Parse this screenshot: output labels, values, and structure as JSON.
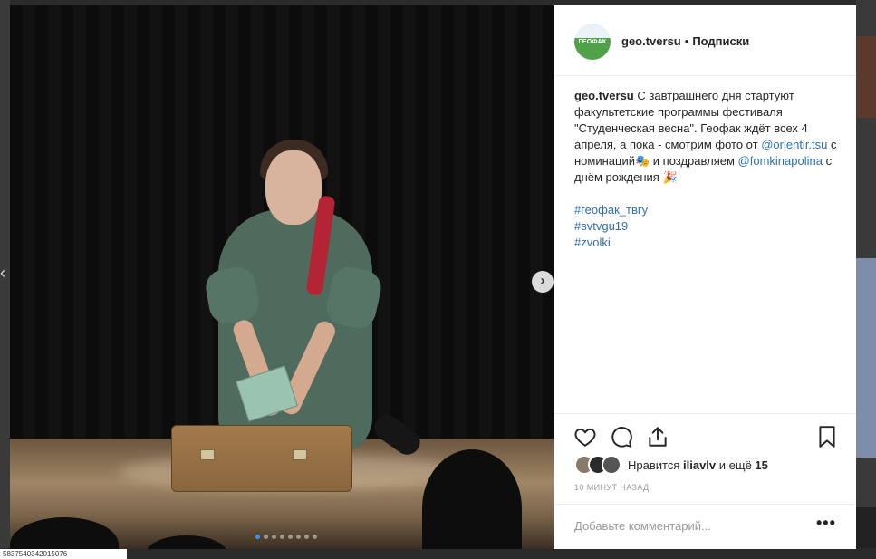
{
  "header": {
    "username": "geo.tversu",
    "separator": "•",
    "follow_label": "Подписки",
    "avatar_text": "ГЕОФАК"
  },
  "caption": {
    "username": "geo.tversu",
    "text_1": "С завтрашнего дня стартуют факультетские программы фестиваля \"Студенческая весна\". Геофак ждёт всех 4 апреля, а пока - смотрим фото от",
    "mention_1": "@orientir.tsu",
    "text_2": "с номинаций🎭 и поздравляем",
    "mention_2": "@fomkinapolina",
    "text_3": "с днём рождения 🎉",
    "hashtags": [
      "#геофак_твгу",
      "#svtvgu19",
      "#zvolki"
    ]
  },
  "likes": {
    "prefix": "Нравится",
    "user": "iliavlv",
    "suffix": "и ещё",
    "count": "15"
  },
  "time_ago": "10 МИНУТ НАЗАД",
  "comment": {
    "placeholder": "Добавьте комментарий...",
    "more": "•••"
  },
  "carousel": {
    "total_slides": 8,
    "active_slide": 1
  },
  "bottom_tag": "5837540342015076",
  "colors": {
    "accent": "#3897f0",
    "link": "#2f6fb0",
    "dress": "#4e6b5e"
  }
}
